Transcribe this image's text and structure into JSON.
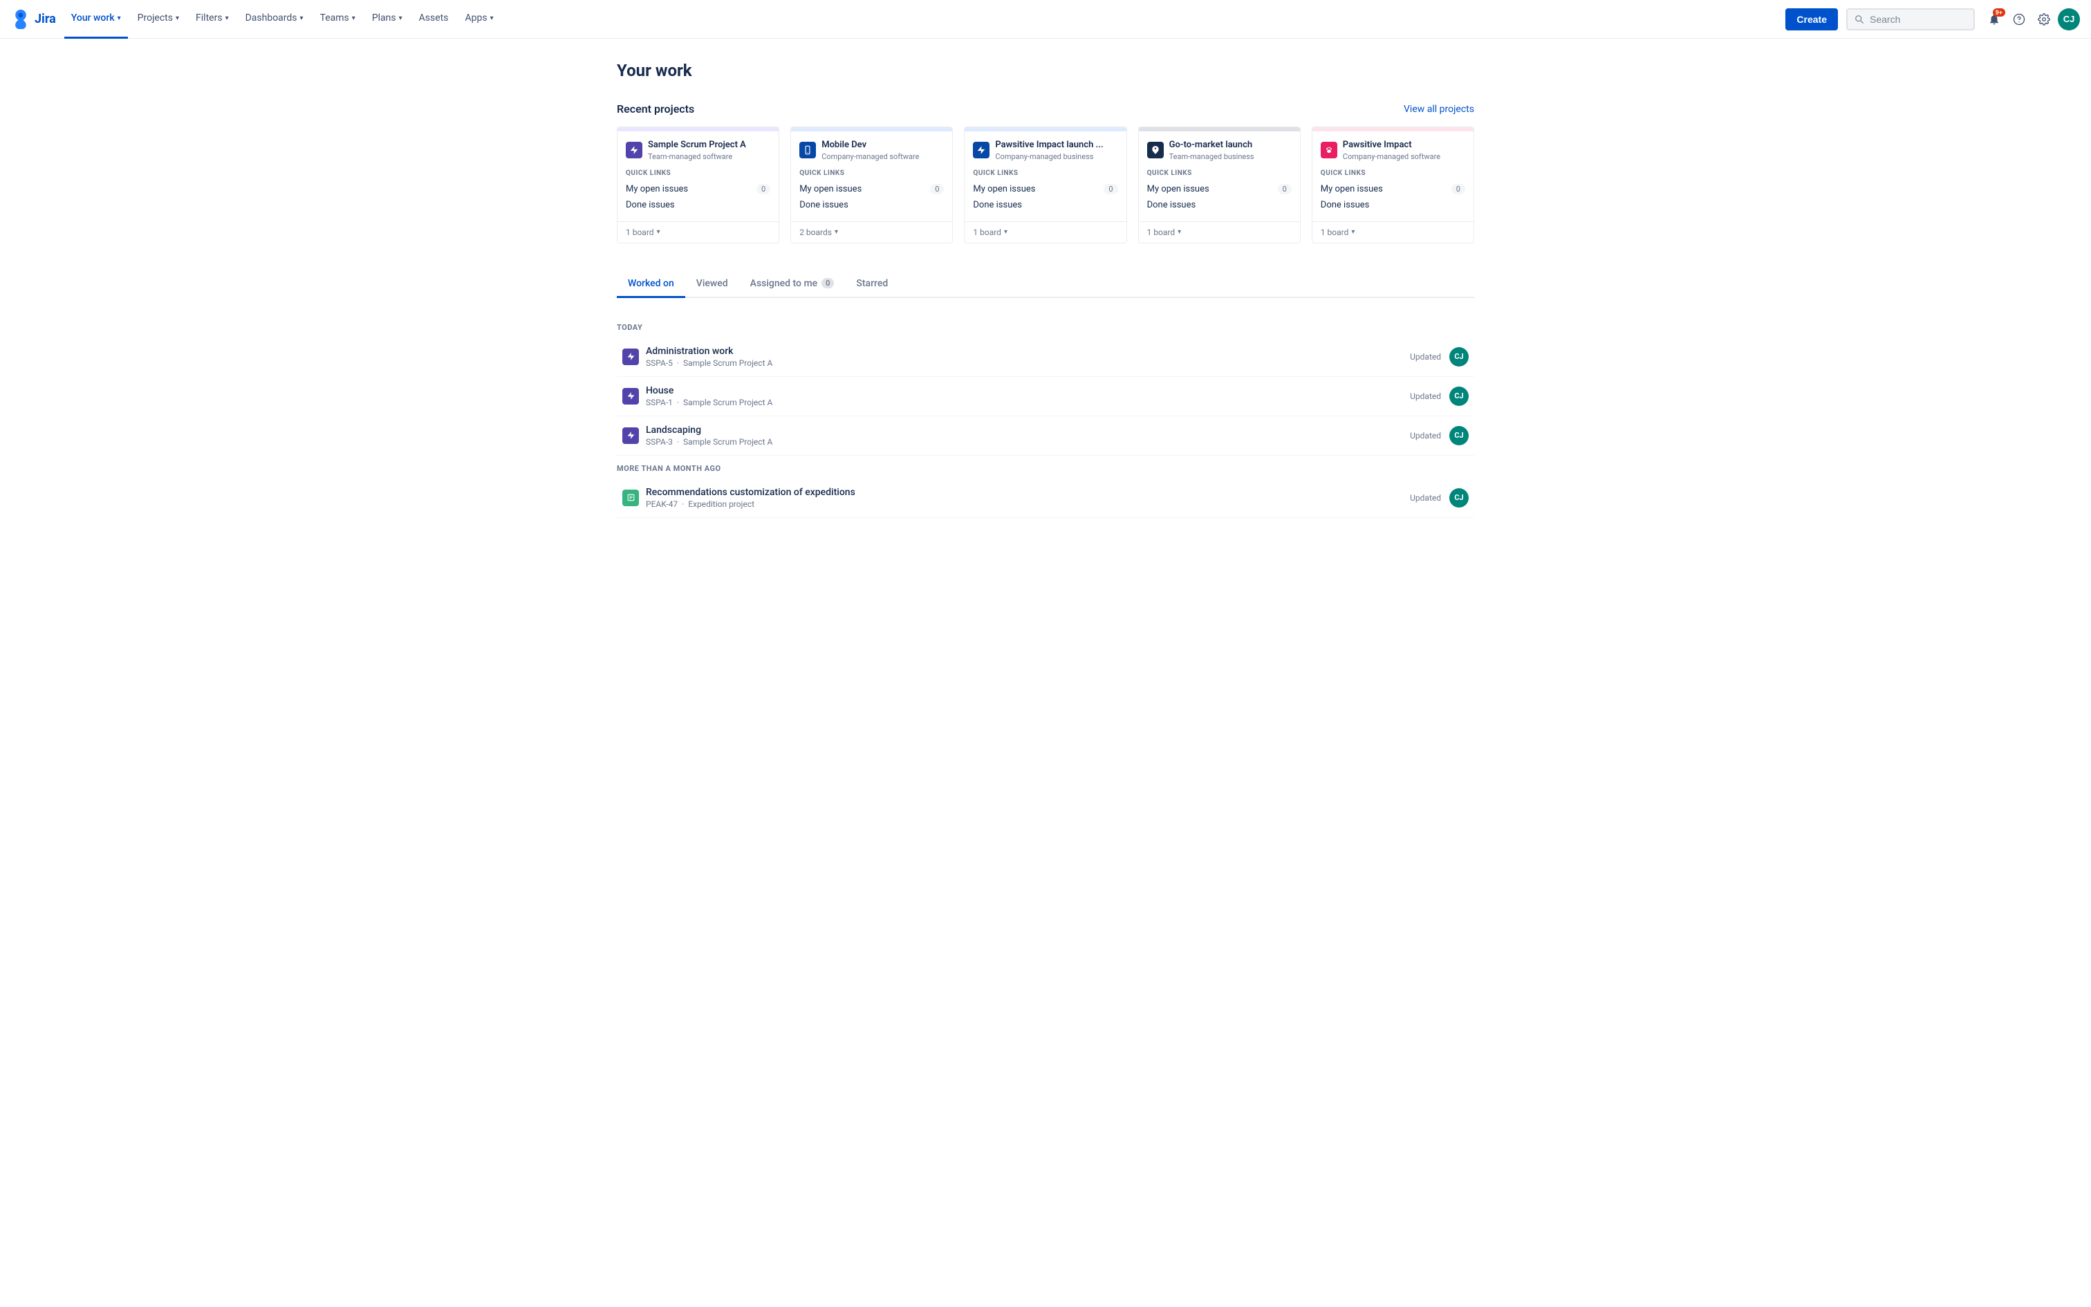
{
  "nav": {
    "logo_text": "Jira",
    "items": [
      {
        "id": "your-work",
        "label": "Your work",
        "active": true,
        "has_dropdown": true
      },
      {
        "id": "projects",
        "label": "Projects",
        "active": false,
        "has_dropdown": true
      },
      {
        "id": "filters",
        "label": "Filters",
        "active": false,
        "has_dropdown": true
      },
      {
        "id": "dashboards",
        "label": "Dashboards",
        "active": false,
        "has_dropdown": true
      },
      {
        "id": "teams",
        "label": "Teams",
        "active": false,
        "has_dropdown": true
      },
      {
        "id": "plans",
        "label": "Plans",
        "active": false,
        "has_dropdown": true
      },
      {
        "id": "assets",
        "label": "Assets",
        "active": false,
        "has_dropdown": false
      },
      {
        "id": "apps",
        "label": "Apps",
        "active": false,
        "has_dropdown": true
      }
    ],
    "create_label": "Create",
    "search_placeholder": "Search",
    "notification_count": "9+",
    "avatar_initials": "CJ"
  },
  "page": {
    "title": "Your work"
  },
  "recent_projects": {
    "section_title": "Recent projects",
    "view_all_label": "View all projects",
    "projects": [
      {
        "id": "sspa",
        "name": "Sample Scrum Project A",
        "type": "Team-managed software",
        "icon_color": "#5243aa",
        "icon_bg": "#eae6ff",
        "header_color": "#eae6ff",
        "icon_text": "⚡",
        "quick_links_label": "QUICK LINKS",
        "links": [
          {
            "label": "My open issues",
            "count": "0"
          },
          {
            "label": "Done issues",
            "count": null
          }
        ],
        "board_count": "1 board"
      },
      {
        "id": "mdev",
        "name": "Mobile Dev",
        "type": "Company-managed software",
        "icon_color": "#0747a6",
        "icon_bg": "#deebff",
        "header_color": "#deebff",
        "icon_text": "📱",
        "quick_links_label": "QUICK LINKS",
        "links": [
          {
            "label": "My open issues",
            "count": "0"
          },
          {
            "label": "Done issues",
            "count": null
          }
        ],
        "board_count": "2 boards"
      },
      {
        "id": "pil",
        "name": "Pawsitive Impact launch ...",
        "type": "Company-managed business",
        "icon_color": "#0747a6",
        "icon_bg": "#deebff",
        "header_color": "#deebff",
        "icon_text": "⚡",
        "quick_links_label": "QUICK LINKS",
        "links": [
          {
            "label": "My open issues",
            "count": "0"
          },
          {
            "label": "Done issues",
            "count": null
          }
        ],
        "board_count": "1 board"
      },
      {
        "id": "gtm",
        "name": "Go-to-market launch",
        "type": "Team-managed business",
        "icon_color": "#172b4d",
        "icon_bg": "#dfe1e6",
        "header_color": "#dfe1e6",
        "icon_text": "🚀",
        "quick_links_label": "QUICK LINKS",
        "links": [
          {
            "label": "My open issues",
            "count": "0"
          },
          {
            "label": "Done issues",
            "count": null
          }
        ],
        "board_count": "1 board"
      },
      {
        "id": "pi",
        "name": "Pawsitive Impact",
        "type": "Company-managed software",
        "icon_color": "#e91e63",
        "icon_bg": "#fce4ec",
        "header_color": "#fce4ec",
        "icon_text": "🐾",
        "quick_links_label": "QUICK LINKS",
        "links": [
          {
            "label": "My open issues",
            "count": "0"
          },
          {
            "label": "Done issues",
            "count": null
          }
        ],
        "board_count": "1 board"
      }
    ]
  },
  "tabs": [
    {
      "id": "worked-on",
      "label": "Worked on",
      "active": true,
      "badge": null
    },
    {
      "id": "viewed",
      "label": "Viewed",
      "active": false,
      "badge": null
    },
    {
      "id": "assigned-to-me",
      "label": "Assigned to me",
      "active": false,
      "badge": "0"
    },
    {
      "id": "starred",
      "label": "Starred",
      "active": false,
      "badge": null
    }
  ],
  "worked_on": {
    "groups": [
      {
        "label": "TODAY",
        "items": [
          {
            "title": "Administration work",
            "key": "SSPA-5",
            "project": "Sample Scrum Project A",
            "icon_color": "#5243aa",
            "icon_text": "⚡",
            "status": "Updated",
            "avatar": "CJ"
          },
          {
            "title": "House",
            "key": "SSPA-1",
            "project": "Sample Scrum Project A",
            "icon_color": "#5243aa",
            "icon_text": "⚡",
            "status": "Updated",
            "avatar": "CJ"
          },
          {
            "title": "Landscaping",
            "key": "SSPA-3",
            "project": "Sample Scrum Project A",
            "icon_color": "#5243aa",
            "icon_text": "⚡",
            "status": "Updated",
            "avatar": "CJ"
          }
        ]
      },
      {
        "label": "MORE THAN A MONTH AGO",
        "items": [
          {
            "title": "Recommendations customization of expeditions",
            "key": "PEAK-47",
            "project": "Expedition project",
            "icon_color": "#36b37e",
            "icon_text": "📋",
            "status": "Updated",
            "avatar": "CJ"
          }
        ]
      }
    ]
  }
}
